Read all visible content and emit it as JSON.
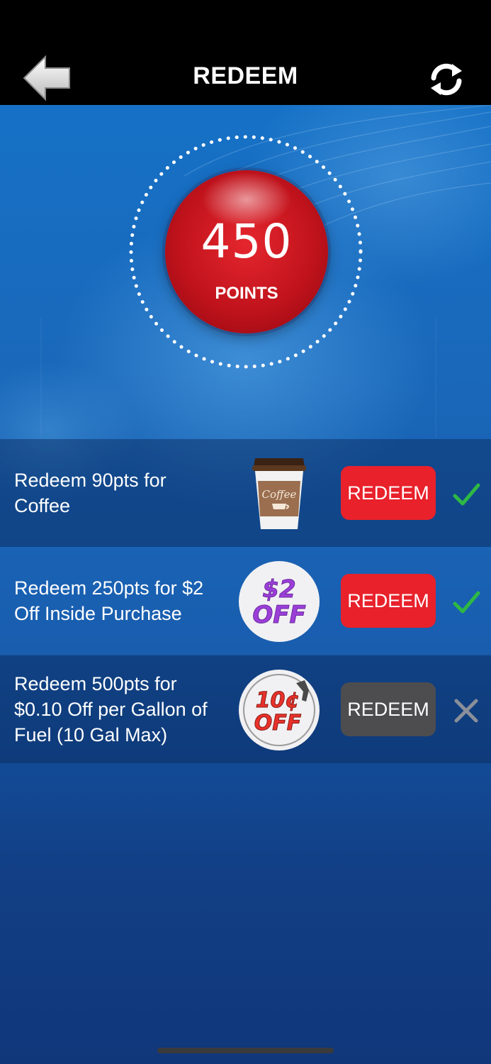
{
  "header": {
    "title": "REDEEM",
    "back_icon": "back-arrow-icon",
    "refresh_icon": "refresh-icon"
  },
  "points": {
    "value": "450",
    "label": "POINTS"
  },
  "rewards": [
    {
      "text": "Redeem 90pts for Coffee",
      "image": "coffee-cup-image",
      "image_label": "Coffee",
      "button": "REDEEM",
      "available": true,
      "status_icon": "check-icon"
    },
    {
      "text": "Redeem 250pts for $2 Off Inside Purchase",
      "image": "two-dollar-off-badge",
      "badge_line1": "$2",
      "badge_line2": "OFF",
      "button": "REDEEM",
      "available": true,
      "status_icon": "check-icon"
    },
    {
      "text": "Redeem 500pts for $0.10 Off per Gallon of Fuel (10 Gal Max)",
      "image": "ten-cent-off-badge",
      "badge_line1": "10¢",
      "badge_line2": "OFF",
      "button": "REDEEM",
      "available": false,
      "status_icon": "x-icon"
    }
  ],
  "colors": {
    "redeem_active": "#e8212b",
    "redeem_inactive": "#4d4d4f",
    "check": "#2fb844",
    "x_mark": "#8a8f99"
  }
}
